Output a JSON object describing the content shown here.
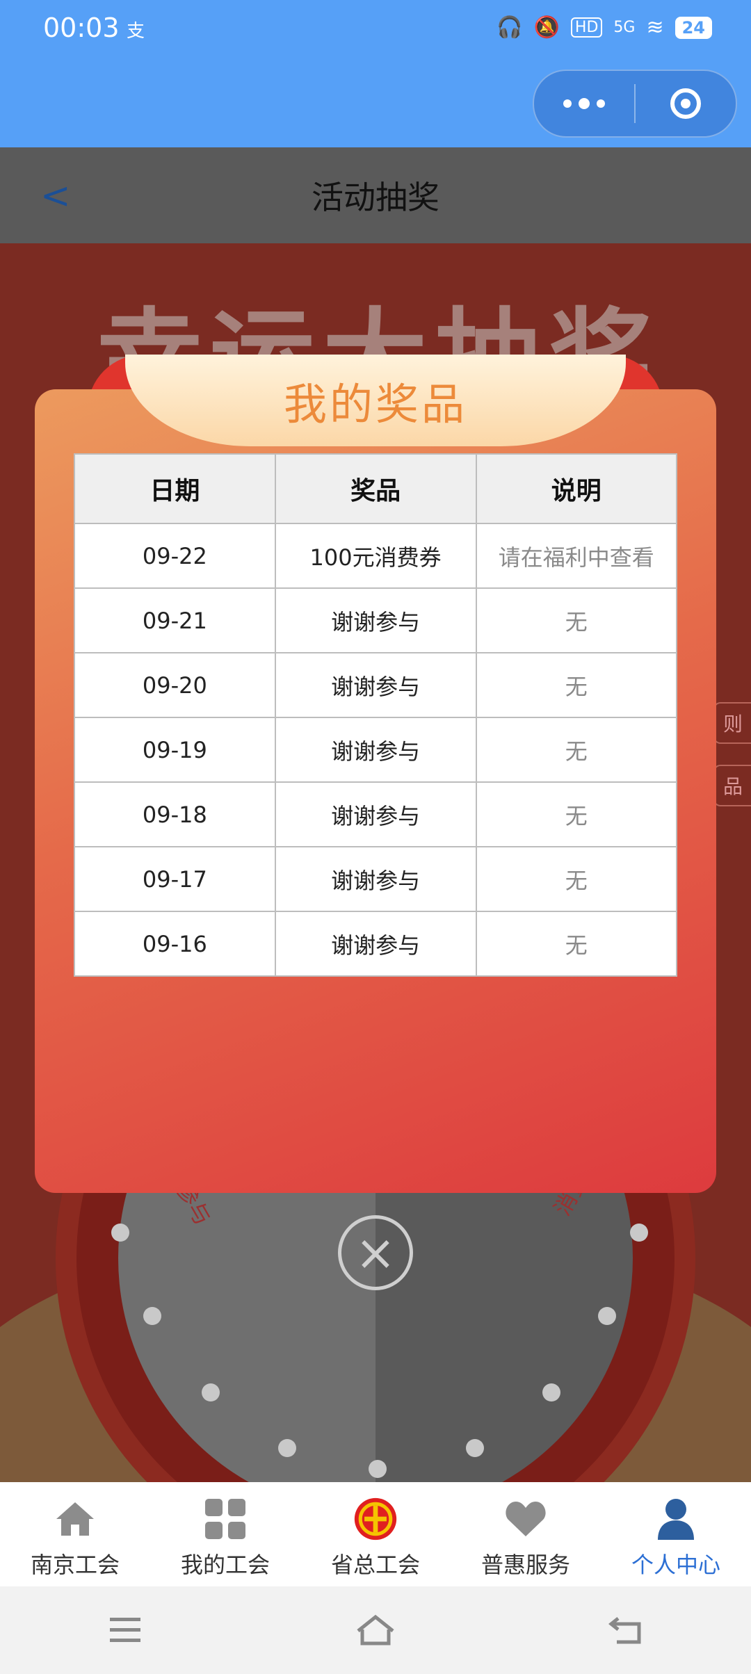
{
  "status_bar": {
    "time": "00:03",
    "alipay_glyph": "支",
    "battery": "24",
    "network": "5G",
    "hd": "HD"
  },
  "nav": {
    "title": "活动抽奖"
  },
  "background": {
    "headline": "幸运大抽奖",
    "side_tab_1": "则",
    "side_tab_2": "品",
    "wheel_label_left": "谢谢参与",
    "wheel_label_right": "消费券"
  },
  "modal": {
    "title": "我的奖品",
    "columns": [
      "日期",
      "奖品",
      "说明"
    ],
    "rows": [
      {
        "date": "09-22",
        "prize": "100元消费券",
        "note": "请在福利中查看"
      },
      {
        "date": "09-21",
        "prize": "谢谢参与",
        "note": "无"
      },
      {
        "date": "09-20",
        "prize": "谢谢参与",
        "note": "无"
      },
      {
        "date": "09-19",
        "prize": "谢谢参与",
        "note": "无"
      },
      {
        "date": "09-18",
        "prize": "谢谢参与",
        "note": "无"
      },
      {
        "date": "09-17",
        "prize": "谢谢参与",
        "note": "无"
      },
      {
        "date": "09-16",
        "prize": "谢谢参与",
        "note": "无"
      }
    ]
  },
  "tab_bar": {
    "items": [
      {
        "label": "南京工会",
        "icon": "home-icon"
      },
      {
        "label": "我的工会",
        "icon": "grid-icon"
      },
      {
        "label": "省总工会",
        "icon": "union-emblem-icon"
      },
      {
        "label": "普惠服务",
        "icon": "heart-icon"
      },
      {
        "label": "个人中心",
        "icon": "person-icon"
      }
    ],
    "active_index": 4
  },
  "colors": {
    "status_bar": "#56a0f7",
    "active_tab": "#2c6fd4",
    "modal_title": "#ec8a3a"
  }
}
